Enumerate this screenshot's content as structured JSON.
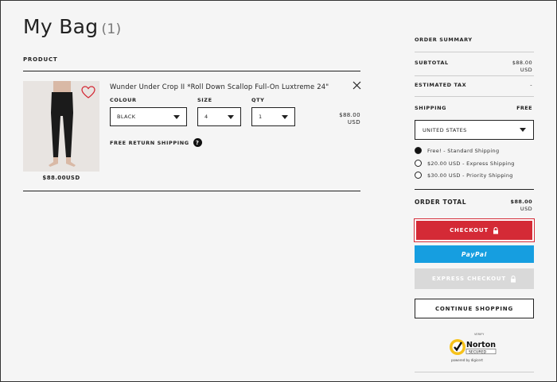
{
  "page": {
    "title": "My Bag",
    "item_count": "(1)"
  },
  "bag": {
    "product_header": "PRODUCT",
    "item": {
      "name": "Wunder Under Crop II *Roll Down Scallop Full-On Luxtreme 24\"",
      "image_price": "$88.00USD",
      "colour_label": "COLOUR",
      "colour_value": "BLACK",
      "size_label": "SIZE",
      "size_value": "4",
      "qty_label": "QTY",
      "qty_value": "1",
      "price_amount": "$88.00",
      "price_currency": "USD",
      "free_return": "FREE RETURN SHIPPING",
      "help_symbol": "?"
    }
  },
  "summary": {
    "heading": "ORDER SUMMARY",
    "subtotal_label": "SUBTOTAL",
    "subtotal_amount": "$88.00",
    "subtotal_currency": "USD",
    "tax_label": "ESTIMATED TAX",
    "tax_value": "-",
    "shipping_label": "SHIPPING",
    "shipping_value": "FREE",
    "country": "UNITED STATES",
    "shipping_options": [
      {
        "label": "Free! - Standard Shipping",
        "selected": true
      },
      {
        "label": "$20.00 USD - Express Shipping",
        "selected": false
      },
      {
        "label": "$30.00 USD - Priority Shipping",
        "selected": false
      }
    ],
    "total_label": "ORDER TOTAL",
    "total_amount": "$88.00",
    "total_currency": "USD"
  },
  "buttons": {
    "checkout": "CHECKOUT",
    "paypal": "PayPal",
    "express": "EXPRESS CHECKOUT",
    "continue": "CONTINUE SHOPPING"
  },
  "badge": {
    "top": "VERIFY",
    "name": "Norton",
    "secured": "SECURED",
    "powered": "powered by digicert"
  },
  "colors": {
    "checkout": "#d42a36",
    "paypal": "#169ee0",
    "express_disabled": "#d9d9d9",
    "norton_yellow": "#f7c21a"
  }
}
